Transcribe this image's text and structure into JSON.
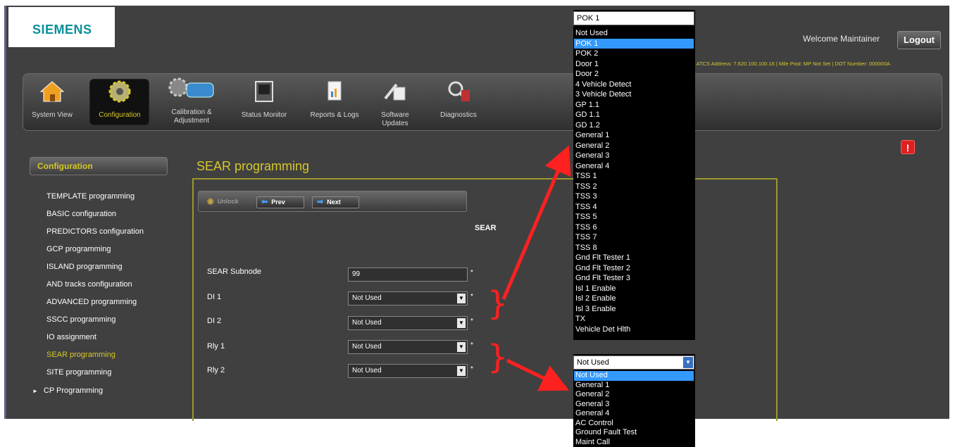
{
  "brand": {
    "logo_text": "SIEMENS"
  },
  "header": {
    "welcome": "Welcome Maintainer",
    "logout_label": "Logout",
    "address_line": "| ATCS Address: 7.620.100.100.16 | Mile Post: MP Not Set | DOT Number: 000000A"
  },
  "toolbar": {
    "items": [
      {
        "label": "System View",
        "icon": "house-icon"
      },
      {
        "label": "Configuration",
        "icon": "gears-icon"
      },
      {
        "label": "Calibration & Adjustment",
        "icon": "calibration-train-icon"
      },
      {
        "label": "Status Monitor",
        "icon": "monitor-icon"
      },
      {
        "label": "Reports & Logs",
        "icon": "report-icon"
      },
      {
        "label": "Software Updates",
        "icon": "software-update-icon"
      },
      {
        "label": "Diagnostics",
        "icon": "diagnostics-icon"
      }
    ],
    "active": "Configuration"
  },
  "alert": {
    "glyph": "!"
  },
  "sidebar": {
    "header": "Configuration",
    "items": [
      "TEMPLATE programming",
      "BASIC configuration",
      "PREDICTORS configuration",
      "GCP programming",
      "ISLAND programming",
      "AND tracks configuration",
      "ADVANCED programming",
      "SSCC programming",
      "IO assignment",
      "SEAR programming",
      "SITE programming"
    ],
    "active": "SEAR programming",
    "collapsible": {
      "arrow": "►",
      "label": "CP Programming"
    }
  },
  "main": {
    "title": "SEAR programming",
    "buttons": {
      "unlock": "Unlock",
      "prev": "Prev",
      "next": "Next"
    },
    "section_title": "SEAR",
    "fields": [
      {
        "label": "SEAR Subnode",
        "value": "99",
        "type": "input"
      },
      {
        "label": "DI 1",
        "value": "Not Used",
        "type": "select"
      },
      {
        "label": "DI 2",
        "value": "Not Used",
        "type": "select"
      },
      {
        "label": "Rly 1",
        "value": "Not Used",
        "type": "select"
      },
      {
        "label": "Rly 2",
        "value": "Not Used",
        "type": "select"
      }
    ],
    "required_marker": "*"
  },
  "dropdown_di": {
    "selected_value": "POK 1",
    "options": [
      "Not Used",
      "POK 1",
      "POK 2",
      "Door 1",
      "Door 2",
      "4 Vehicle Detect",
      "3 Vehicle Detect",
      "GP 1.1",
      "GD 1.1",
      "GD 1.2",
      "General 1",
      "General 2",
      "General 3",
      "General 4",
      "TSS 1",
      "TSS 2",
      "TSS 3",
      "TSS 4",
      "TSS 5",
      "TSS 6",
      "TSS 7",
      "TSS 8",
      "Gnd Flt Tester 1",
      "Gnd Flt Tester 2",
      "Gnd Flt Tester 3",
      "Isl 1 Enable",
      "Isl 2 Enable",
      "Isl 3 Enable",
      "TX",
      "Vehicle Det Hlth"
    ],
    "highlighted": "POK 1"
  },
  "dropdown_rly": {
    "selected_value": "Not Used",
    "options": [
      "Not Used",
      "General 1",
      "General 2",
      "General 3",
      "General 4",
      "AC Control",
      "Ground Fault Test",
      "Maint Call"
    ],
    "highlighted": "Not Used"
  },
  "colors": {
    "accent": "#d6c82a",
    "highlight": "#3399ff",
    "annotation": "#ff2020"
  }
}
